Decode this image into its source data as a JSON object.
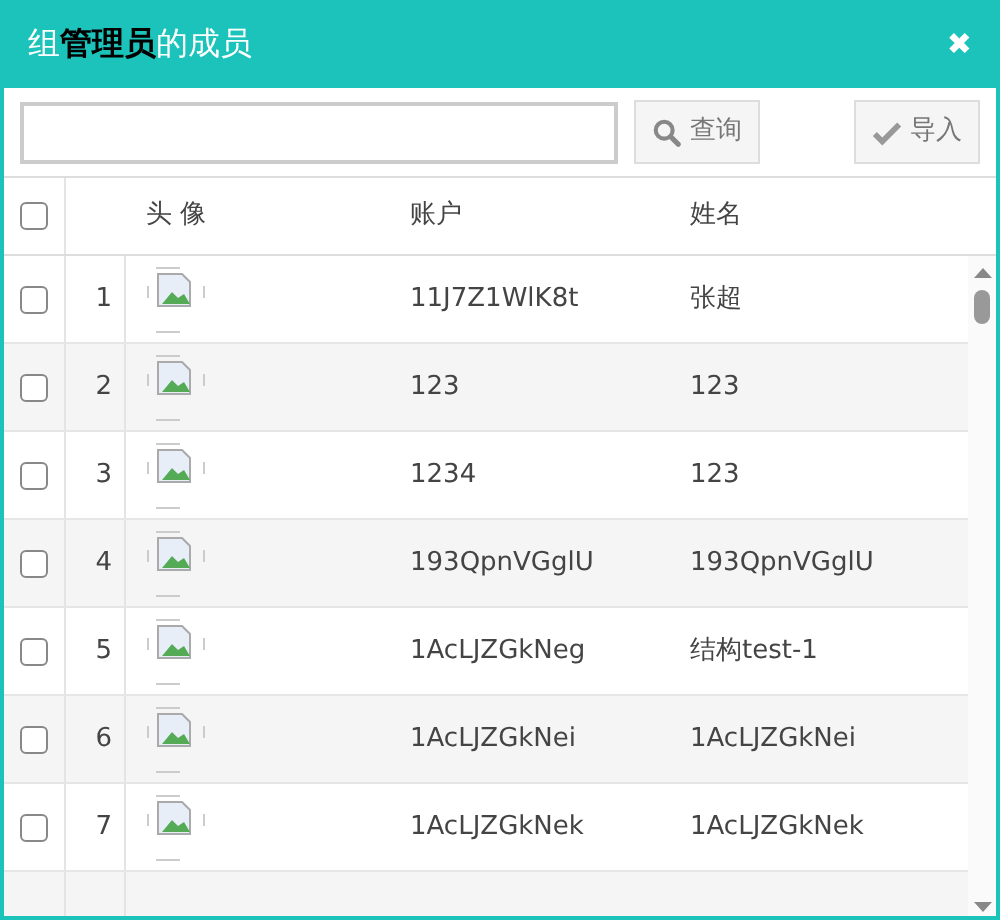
{
  "dialog": {
    "title": "组**管理员**的成员",
    "close": "✖"
  },
  "toolbar": {
    "query_button": "查询",
    "import_button": "导入"
  },
  "table": {
    "columns": [
      {
        "label": "头 像"
      },
      {
        "label": "账户"
      },
      {
        "label": "姓名"
      }
    ],
    "select_all": {
      "checked": false
    },
    "rows": [
      {
        "index": "1",
        "checked": false,
        "account": "11J7Z1WlK8t",
        "name": "张超"
      },
      {
        "index": "2",
        "checked": false,
        "account": "123",
        "name": "123"
      },
      {
        "index": "3",
        "checked": false,
        "account": "1234",
        "name": "123"
      },
      {
        "index": "4",
        "checked": false,
        "account": "193QpnVGglU",
        "name": "193QpnVGglU"
      },
      {
        "index": "5",
        "checked": false,
        "account": "1AcLJZGkNeg",
        "name": "结构test-1"
      },
      {
        "index": "6",
        "checked": false,
        "account": "1AcLJZGkNei",
        "name": "1AcLJZGkNei"
      },
      {
        "index": "7",
        "checked": false,
        "account": "1AcLJZGkNek",
        "name": "1AcLJZGkNek"
      }
    ]
  }
}
